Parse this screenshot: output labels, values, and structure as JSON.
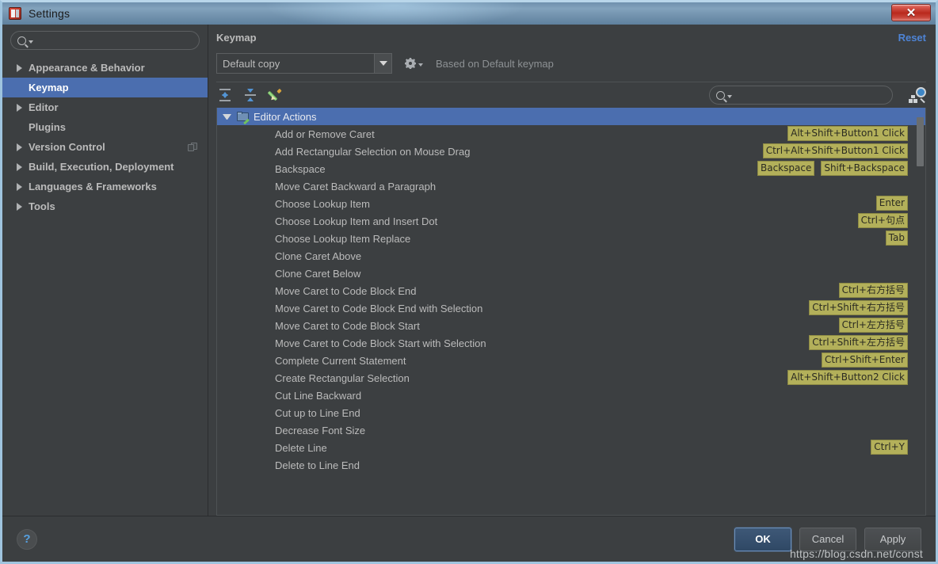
{
  "window": {
    "title": "Settings",
    "app_icon": "intellij-app-icon",
    "close_label": "✕"
  },
  "sidebar": {
    "search": {
      "placeholder": "",
      "value": "",
      "icon": "search-icon"
    },
    "items": [
      {
        "label": "Appearance & Behavior",
        "expandable": true,
        "selected": false,
        "trailing_icon": ""
      },
      {
        "label": "Keymap",
        "expandable": false,
        "selected": true,
        "trailing_icon": ""
      },
      {
        "label": "Editor",
        "expandable": true,
        "selected": false,
        "trailing_icon": ""
      },
      {
        "label": "Plugins",
        "expandable": false,
        "selected": false,
        "trailing_icon": ""
      },
      {
        "label": "Version Control",
        "expandable": true,
        "selected": false,
        "trailing_icon": "copy-icon"
      },
      {
        "label": "Build, Execution, Deployment",
        "expandable": true,
        "selected": false,
        "trailing_icon": ""
      },
      {
        "label": "Languages & Frameworks",
        "expandable": true,
        "selected": false,
        "trailing_icon": ""
      },
      {
        "label": "Tools",
        "expandable": true,
        "selected": false,
        "trailing_icon": ""
      }
    ]
  },
  "main": {
    "panel_title": "Keymap",
    "reset_label": "Reset",
    "keymap_selected": "Default copy",
    "based_on": "Based on Default keymap",
    "toolbar": {
      "expand_all": "expand-all-icon",
      "collapse_all": "collapse-all-icon",
      "edit": "edit-pencil-icon",
      "find_by_shortcut": "find-by-shortcut-icon"
    },
    "tree_search": {
      "placeholder": "",
      "value": ""
    }
  },
  "tree": {
    "group": {
      "label": "Editor Actions",
      "expanded": true,
      "selected": true,
      "icon": "keymap-folder-icon"
    },
    "rows": [
      {
        "label": "Add or Remove Caret",
        "shortcuts": [
          "Alt+Shift+Button1 Click"
        ]
      },
      {
        "label": "Add Rectangular Selection on Mouse Drag",
        "shortcuts": [
          "Ctrl+Alt+Shift+Button1 Click"
        ]
      },
      {
        "label": "Backspace",
        "shortcuts": [
          "Backspace",
          "Shift+Backspace"
        ]
      },
      {
        "label": "Move Caret Backward a Paragraph",
        "shortcuts": []
      },
      {
        "label": "Choose Lookup Item",
        "shortcuts": [
          "Enter"
        ]
      },
      {
        "label": "Choose Lookup Item and Insert Dot",
        "shortcuts": [
          "Ctrl+句点"
        ]
      },
      {
        "label": "Choose Lookup Item Replace",
        "shortcuts": [
          "Tab"
        ]
      },
      {
        "label": "Clone Caret Above",
        "shortcuts": []
      },
      {
        "label": "Clone Caret Below",
        "shortcuts": []
      },
      {
        "label": "Move Caret to Code Block End",
        "shortcuts": [
          "Ctrl+右方括号"
        ]
      },
      {
        "label": "Move Caret to Code Block End with Selection",
        "shortcuts": [
          "Ctrl+Shift+右方括号"
        ]
      },
      {
        "label": "Move Caret to Code Block Start",
        "shortcuts": [
          "Ctrl+左方括号"
        ]
      },
      {
        "label": "Move Caret to Code Block Start with Selection",
        "shortcuts": [
          "Ctrl+Shift+左方括号"
        ]
      },
      {
        "label": "Complete Current Statement",
        "shortcuts": [
          "Ctrl+Shift+Enter"
        ]
      },
      {
        "label": "Create Rectangular Selection",
        "shortcuts": [
          "Alt+Shift+Button2 Click"
        ]
      },
      {
        "label": "Cut Line Backward",
        "shortcuts": []
      },
      {
        "label": "Cut up to Line End",
        "shortcuts": []
      },
      {
        "label": "Decrease Font Size",
        "shortcuts": []
      },
      {
        "label": "Delete Line",
        "shortcuts": [
          "Ctrl+Y"
        ]
      },
      {
        "label": "Delete to Line End",
        "shortcuts": []
      }
    ]
  },
  "footer": {
    "help_label": "?",
    "ok_label": "OK",
    "cancel_label": "Cancel",
    "apply_label": "Apply",
    "watermark": "https://blog.csdn.net/const"
  },
  "colors": {
    "accent_selection": "#4b6eaf",
    "link": "#4e84d6",
    "shortcut_badge": "#b3b05a",
    "panel_bg": "#3c3f41"
  }
}
